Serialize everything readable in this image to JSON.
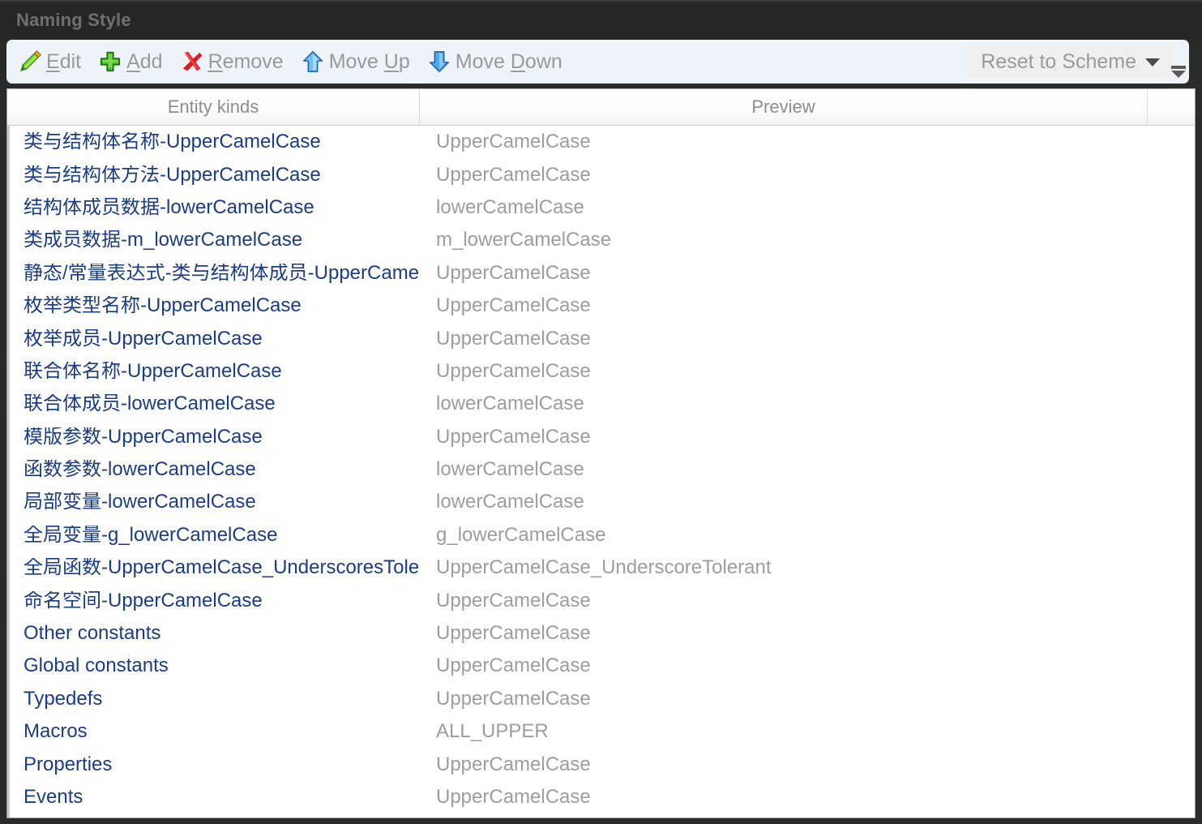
{
  "window": {
    "title": "Naming Style"
  },
  "toolbar": {
    "items": [
      {
        "label_pre": "",
        "label_accel": "E",
        "label_post": "dit",
        "icon": "pencil-icon",
        "name": "edit"
      },
      {
        "label_pre": "",
        "label_accel": "A",
        "label_post": "dd",
        "icon": "plus-icon",
        "name": "add"
      },
      {
        "label_pre": "",
        "label_accel": "R",
        "label_post": "emove",
        "icon": "red-x-icon",
        "name": "remove"
      },
      {
        "label_pre": "Move ",
        "label_accel": "U",
        "label_post": "p",
        "icon": "arrow-up-icon",
        "name": "move-up"
      },
      {
        "label_pre": "Move ",
        "label_accel": "D",
        "label_post": "own",
        "icon": "arrow-down-icon",
        "name": "move-down"
      }
    ],
    "reset_button": {
      "label": "Reset to Scheme",
      "caret_icon": "chevron-down-icon"
    },
    "overflow_icon": "toolbar-overflow-icon"
  },
  "table": {
    "columns": [
      "Entity kinds",
      "Preview",
      ""
    ],
    "rows": [
      {
        "entity": "类与结构体名称-UpperCamelCase",
        "preview": "UpperCamelCase"
      },
      {
        "entity": "类与结构体方法-UpperCamelCase",
        "preview": "UpperCamelCase"
      },
      {
        "entity": "结构体成员数据-lowerCamelCase",
        "preview": "lowerCamelCase"
      },
      {
        "entity": "类成员数据-m_lowerCamelCase",
        "preview": "m_lowerCamelCase"
      },
      {
        "entity": "静态/常量表达式-类与结构体成员-UpperCamelCase",
        "preview": "UpperCamelCase"
      },
      {
        "entity": "枚举类型名称-UpperCamelCase",
        "preview": "UpperCamelCase"
      },
      {
        "entity": "枚举成员-UpperCamelCase",
        "preview": "UpperCamelCase"
      },
      {
        "entity": "联合体名称-UpperCamelCase",
        "preview": "UpperCamelCase"
      },
      {
        "entity": "联合体成员-lowerCamelCase",
        "preview": "lowerCamelCase"
      },
      {
        "entity": "模版参数-UpperCamelCase",
        "preview": "UpperCamelCase"
      },
      {
        "entity": "函数参数-lowerCamelCase",
        "preview": "lowerCamelCase"
      },
      {
        "entity": "局部变量-lowerCamelCase",
        "preview": "lowerCamelCase"
      },
      {
        "entity": "全局变量-g_lowerCamelCase",
        "preview": "g_lowerCamelCase"
      },
      {
        "entity": "全局函数-UpperCamelCase_UnderscoresTolerant",
        "preview": "UpperCamelCase_UnderscoreTolerant"
      },
      {
        "entity": "命名空间-UpperCamelCase",
        "preview": "UpperCamelCase"
      },
      {
        "entity": "Other constants",
        "preview": "UpperCamelCase"
      },
      {
        "entity": "Global constants",
        "preview": "UpperCamelCase"
      },
      {
        "entity": "Typedefs",
        "preview": "UpperCamelCase"
      },
      {
        "entity": "Macros",
        "preview": "ALL_UPPER"
      },
      {
        "entity": "Properties",
        "preview": "UpperCamelCase"
      },
      {
        "entity": "Events",
        "preview": "UpperCamelCase"
      }
    ]
  },
  "colors": {
    "titlebar_bg": "#262626",
    "toolbar_bg": "#eef3fa",
    "entity_text": "#1b3c87",
    "preview_text": "#9d9d9d",
    "header_text": "#8c8c88",
    "toolbar_label": "#999999"
  }
}
